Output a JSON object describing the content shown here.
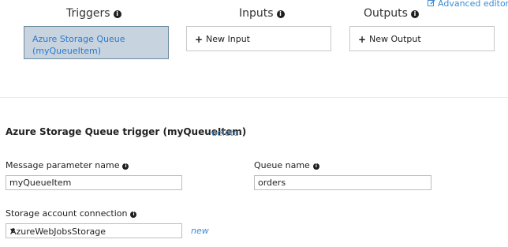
{
  "advanced_editor": {
    "label": "Advanced editor"
  },
  "columns": {
    "triggers": {
      "title": "Triggers",
      "item_line1": "Azure Storage Queue",
      "item_line2": "(myQueueItem)"
    },
    "inputs": {
      "title": "Inputs",
      "button": "New Input"
    },
    "outputs": {
      "title": "Outputs",
      "button": "New Output"
    }
  },
  "trigger_detail": {
    "title": "Azure Storage Queue trigger (myQueueItem)",
    "delete": "delete",
    "message_param": {
      "label": "Message parameter name",
      "value": "myQueueItem"
    },
    "queue_name": {
      "label": "Queue name",
      "value": "orders"
    },
    "storage": {
      "label": "Storage account connection",
      "value": "AzureWebJobsStorage",
      "new": "new"
    }
  },
  "colors": {
    "link": "#3b8cd6",
    "selected_bg": "#c7d3de",
    "selected_border": "#6c8ba0"
  }
}
